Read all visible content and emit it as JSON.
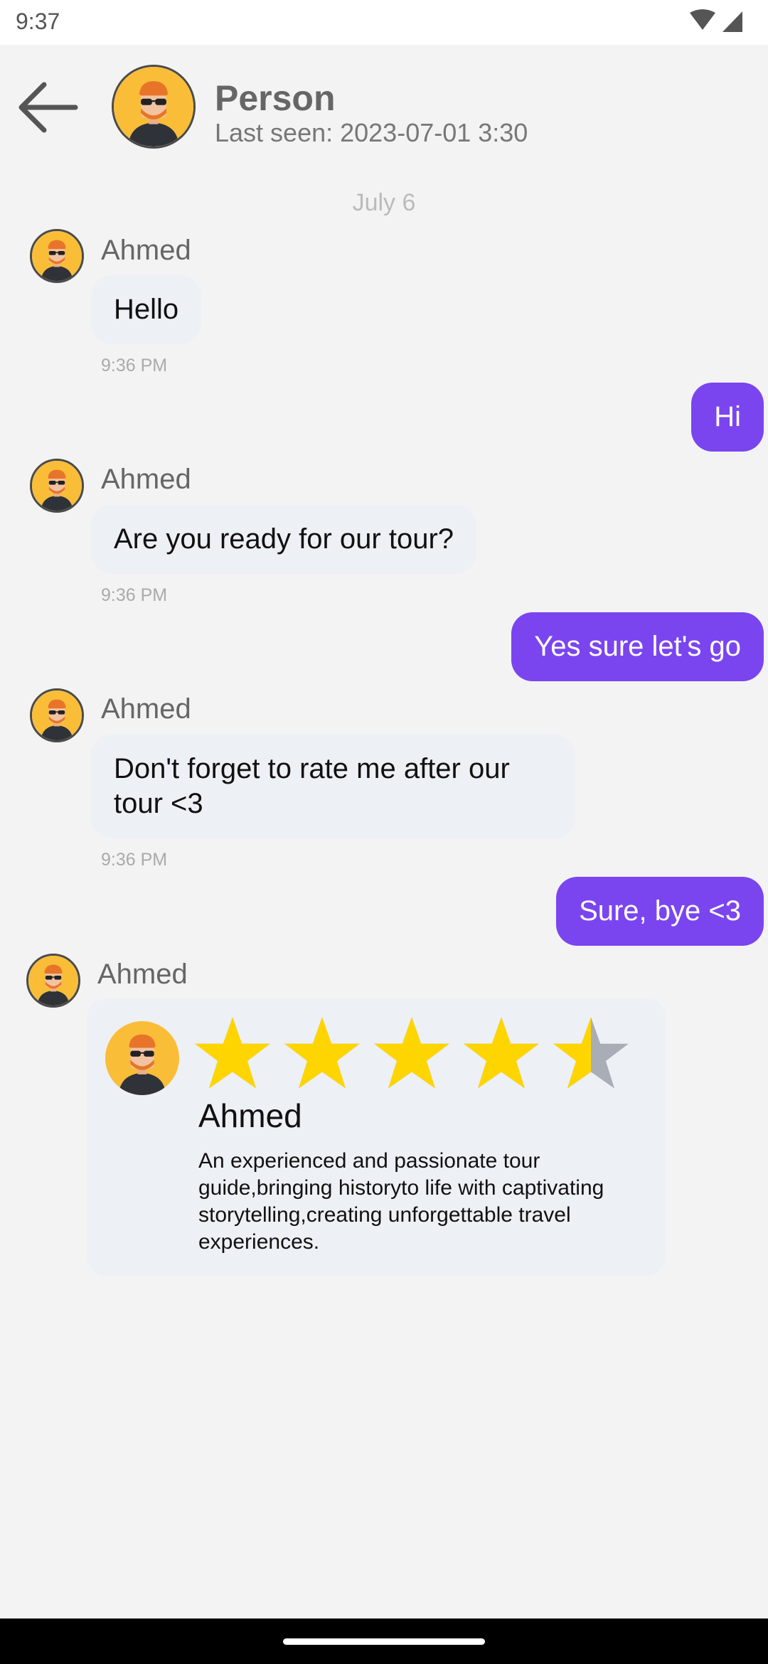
{
  "status_bar": {
    "time": "9:37"
  },
  "header": {
    "name": "Person",
    "last_seen": "Last seen: 2023-07-01 3:30"
  },
  "date_separator": "July 6",
  "messages": [
    {
      "sender": "Ahmed",
      "text": "Hello",
      "time": "9:36 PM"
    },
    {
      "text": "Hi"
    },
    {
      "sender": "Ahmed",
      "text": "Are you ready for our tour?",
      "time": "9:36 PM"
    },
    {
      "text": "Yes sure let's go"
    },
    {
      "sender": "Ahmed",
      "text": "Don't forget to rate me after our tour <3",
      "time": "9:36 PM"
    },
    {
      "text": "Sure, bye <3"
    }
  ],
  "rating_card": {
    "sender": "Ahmed",
    "name": "Ahmed",
    "rating": 4.5,
    "max_rating": 5,
    "description": "An experienced and passionate tour guide,bringing historyto life with captivating storytelling,creating unforgettable travel experiences."
  },
  "colors": {
    "accent": "#7a45ef",
    "incoming_bubble": "#edf0f5",
    "star_filled": "#ffd500",
    "star_empty": "#a9adb5",
    "avatar_bg": "#f9bd38"
  }
}
